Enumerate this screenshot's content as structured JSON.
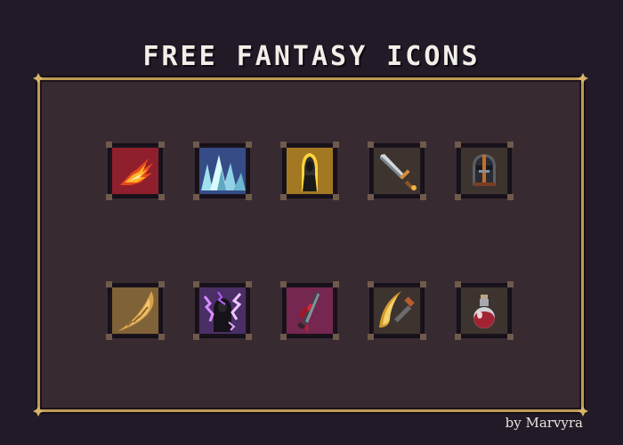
{
  "title": "FREE FANTASY ICONS",
  "credit": "by Marvyra",
  "colors": {
    "background": "#221a27",
    "panel": "#382a31",
    "frame": "#bf9a54",
    "title": "#f2eee8"
  },
  "icons": [
    {
      "icon": "fire-claw-icon",
      "bg": "#8f1f2c"
    },
    {
      "icon": "ice-spikes-icon",
      "bg": "#354c86"
    },
    {
      "icon": "holy-aura-icon",
      "bg": "#a27822"
    },
    {
      "icon": "sword-icon",
      "bg": "#3d342f"
    },
    {
      "icon": "helmet-icon",
      "bg": "#3d342f"
    },
    {
      "icon": "horn-icon",
      "bg": "#806238"
    },
    {
      "icon": "lightning-shadow-icon",
      "bg": "#4a2f67"
    },
    {
      "icon": "bloody-blade-icon",
      "bg": "#75274f"
    },
    {
      "icon": "sickle-icon",
      "bg": "#3d342f"
    },
    {
      "icon": "potion-icon",
      "bg": "#3d342f"
    }
  ]
}
